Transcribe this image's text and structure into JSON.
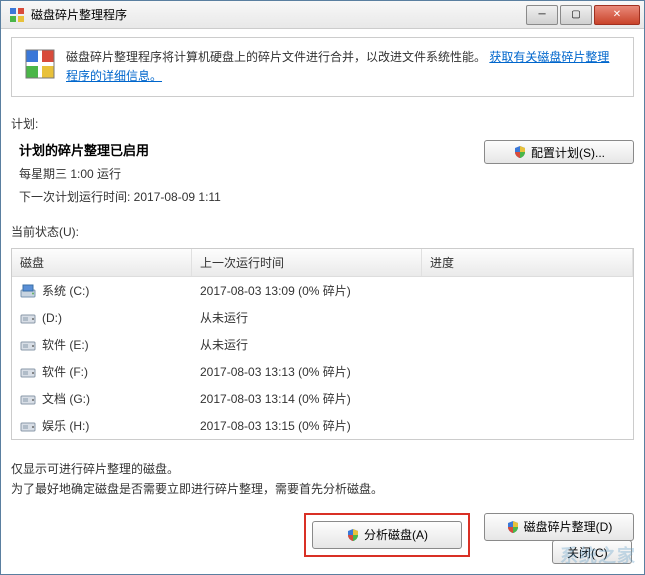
{
  "window": {
    "title": "磁盘碎片整理程序"
  },
  "info": {
    "text": "磁盘碎片整理程序将计算机硬盘上的碎片文件进行合并，以改进文件系统性能。",
    "link": "获取有关磁盘碎片整理程序的详细信息。"
  },
  "schedule": {
    "label": "计划:",
    "enabled_title": "计划的碎片整理已启用",
    "frequency": "每星期三  1:00 运行",
    "next_run_label": "下一次计划运行时间: ",
    "next_run_time": "2017-08-09 1:11",
    "configure_btn": "配置计划(S)..."
  },
  "status": {
    "label": "当前状态(U):"
  },
  "table": {
    "headers": {
      "disk": "磁盘",
      "last": "上一次运行时间",
      "progress": "进度"
    },
    "rows": [
      {
        "icon": "system",
        "name": "系统 (C:)",
        "last": "2017-08-03 13:09 (0% 碎片)"
      },
      {
        "icon": "drive",
        "name": "(D:)",
        "last": "从未运行"
      },
      {
        "icon": "drive",
        "name": "软件 (E:)",
        "last": "从未运行"
      },
      {
        "icon": "drive",
        "name": "软件 (F:)",
        "last": "2017-08-03 13:13 (0% 碎片)"
      },
      {
        "icon": "drive",
        "name": "文档 (G:)",
        "last": "2017-08-03 13:14 (0% 碎片)"
      },
      {
        "icon": "drive",
        "name": "娱乐 (H:)",
        "last": "2017-08-03 13:15 (0% 碎片)"
      }
    ]
  },
  "hint": {
    "line1": "仅显示可进行碎片整理的磁盘。",
    "line2": "为了最好地确定磁盘是否需要立即进行碎片整理，需要首先分析磁盘。"
  },
  "buttons": {
    "analyze": "分析磁盘(A)",
    "defrag": "磁盘碎片整理(D)",
    "close": "关闭(C)"
  },
  "watermark": "系统之家"
}
